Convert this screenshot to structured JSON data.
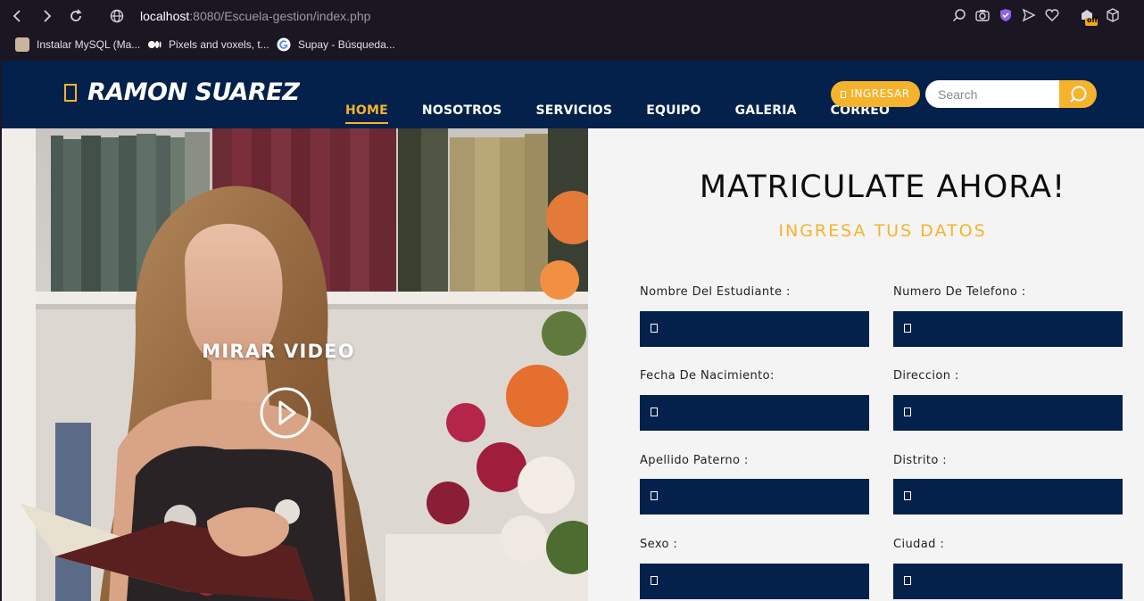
{
  "browser": {
    "url_host": "localhost",
    "url_rest": ":8080/Escuela-gestion/index.php",
    "bookmarks": [
      {
        "label": "Instalar MySQL (Ma..."
      },
      {
        "label": "Pixels and voxels, t..."
      },
      {
        "label": "Supay - Búsqueda..."
      }
    ],
    "ext_badge": "off"
  },
  "header": {
    "logo_text": "RAMON SUAREZ",
    "nav": [
      "HOME",
      "NOSOTROS",
      "SERVICIOS",
      "EQUIPO",
      "GALERIA",
      "CORREO"
    ],
    "active_nav": "HOME",
    "ingresar_label": "INGRESAR",
    "search_placeholder": "Search"
  },
  "hero": {
    "label": "MIRAR VIDEO"
  },
  "form": {
    "title": "MATRICULATE AHORA!",
    "subtitle": "INGRESA TUS DATOS",
    "fields": {
      "nombre": "Nombre Del Estudiante :",
      "telefono": "Numero De Telefono :",
      "nacimiento": "Fecha De Nacimiento:",
      "direccion": "Direccion :",
      "apellido": "Apellido Paterno :",
      "distrito": "Distrito :",
      "sexo": "Sexo :",
      "ciudad": "Ciudad :"
    }
  },
  "colors": {
    "navy": "#03214a",
    "accent": "#f5b32d",
    "form_bg": "#f4f4f4"
  }
}
